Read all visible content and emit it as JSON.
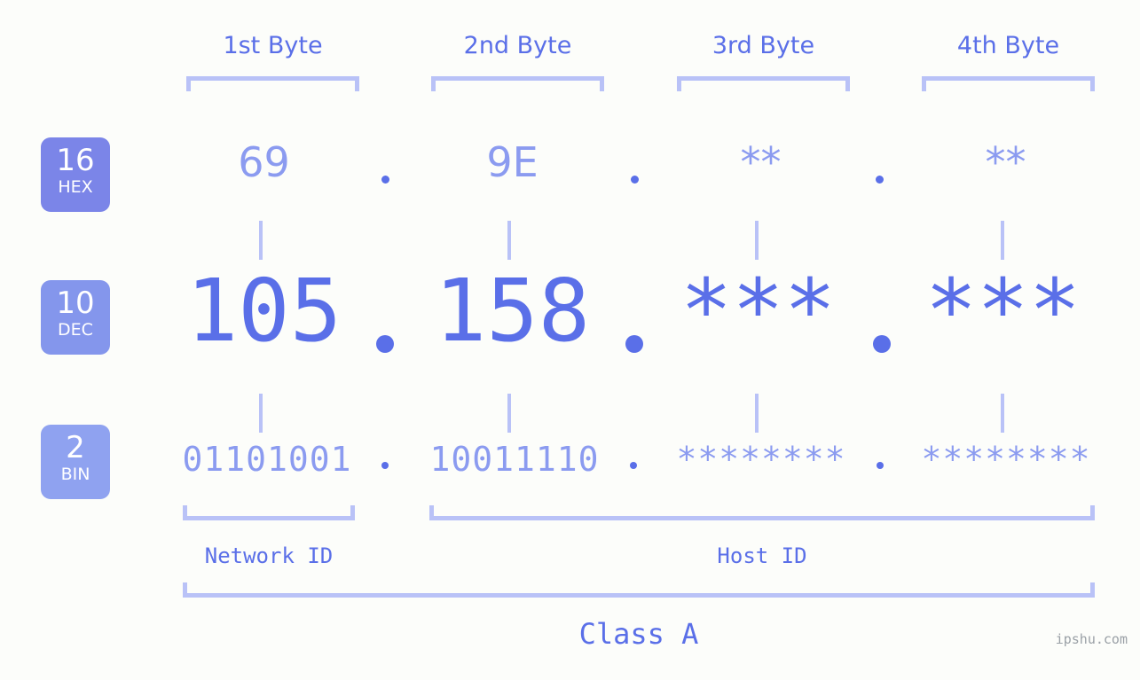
{
  "watermark": "ipshu.com",
  "headers": [
    {
      "label": "1st Byte"
    },
    {
      "label": "2nd Byte"
    },
    {
      "label": "3rd Byte"
    },
    {
      "label": "4th Byte"
    }
  ],
  "bases": [
    {
      "number": "16",
      "name": "HEX",
      "color": "#7b85e8"
    },
    {
      "number": "10",
      "name": "DEC",
      "color": "#8496ec"
    },
    {
      "number": "2",
      "name": "BIN",
      "color": "#8fa2f0"
    }
  ],
  "rows": {
    "hex": {
      "values": [
        "69",
        "9E",
        "**",
        "**"
      ]
    },
    "dec": {
      "values": [
        "105",
        "158",
        "***",
        "***"
      ]
    },
    "bin": {
      "values": [
        "01101001",
        "10011110",
        "********",
        "********"
      ]
    }
  },
  "separator": ".",
  "footer": {
    "network_id": "Network ID",
    "host_id": "Host ID",
    "ip_class": "Class A"
  },
  "colors": {
    "background": "#fcfdfa",
    "accent_strong": "#5a6fe8",
    "accent_light": "#8b9bf0",
    "bracket": "#b9c2f7",
    "watermark": "#9aa0a6"
  },
  "chart_data": {
    "type": "table",
    "title": "IP address byte breakdown",
    "columns": [
      "1st Byte",
      "2nd Byte",
      "3rd Byte",
      "4th Byte"
    ],
    "rows": [
      {
        "base": "HEX",
        "radix": 16,
        "values": [
          "69",
          "9E",
          "**",
          "**"
        ]
      },
      {
        "base": "DEC",
        "radix": 10,
        "values": [
          "105",
          "158",
          "***",
          "***"
        ]
      },
      {
        "base": "BIN",
        "radix": 2,
        "values": [
          "01101001",
          "10011110",
          "********",
          "********"
        ]
      }
    ],
    "annotations": [
      "Network ID",
      "Host ID",
      "Class A"
    ]
  }
}
